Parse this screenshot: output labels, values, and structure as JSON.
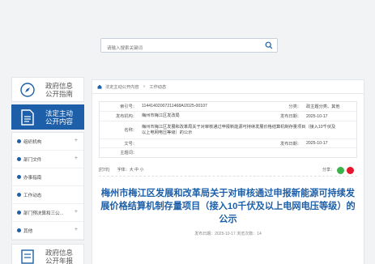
{
  "search": {
    "placeholder": "请输入搜索关键词"
  },
  "sidebar": {
    "cards": [
      {
        "label": "政府信息公开指南"
      },
      {
        "label": "法定主动公开内容"
      }
    ],
    "submenu": [
      {
        "label": "组织机构"
      },
      {
        "label": "部门文件"
      },
      {
        "label": "办事指南"
      },
      {
        "label": "工作动态"
      },
      {
        "label": "部门预决算和三公..."
      },
      {
        "label": "其他"
      }
    ],
    "bottom_card": {
      "label": "政府信息公开年报"
    }
  },
  "breadcrumb": {
    "part1": "法定主动公开内容",
    "sep": "»",
    "part2": "工作动态"
  },
  "meta": {
    "index_key": "索引号：",
    "index_val": "11441402007211468A/2025-00107",
    "category_key": "分类：",
    "category_val": "政主题分类、其他",
    "org_key": "发布机构：",
    "org_val": "梅州市梅江区发改局",
    "date_key": "发布日期：",
    "date_val": "2025-10-17",
    "name_key": "名称：",
    "name_val": "梅州市梅江区发展和改革局关于对审核通过申报新能源可持续发展价格结算机制存量项目（接入10千伏及以上电网电压等级）的公示",
    "docno_key": "文号：",
    "docno_val": "",
    "pubdate_key": "发布日期：",
    "pubdate_val": "2025-10-17",
    "keyword_key": "主题词：",
    "keyword_val": ""
  },
  "tools": {
    "print": "[打印]",
    "font": "字体：大 中 小",
    "share": "分享："
  },
  "article": {
    "title": "梅州市梅江区发展和改革局关于对审核通过申报新能源可持续发展价格结算机制存量项目（接入10千伏及以上电网电压等级）的公示",
    "pubinfo": "发布日期：2025-10-17   浏览次数：14"
  }
}
